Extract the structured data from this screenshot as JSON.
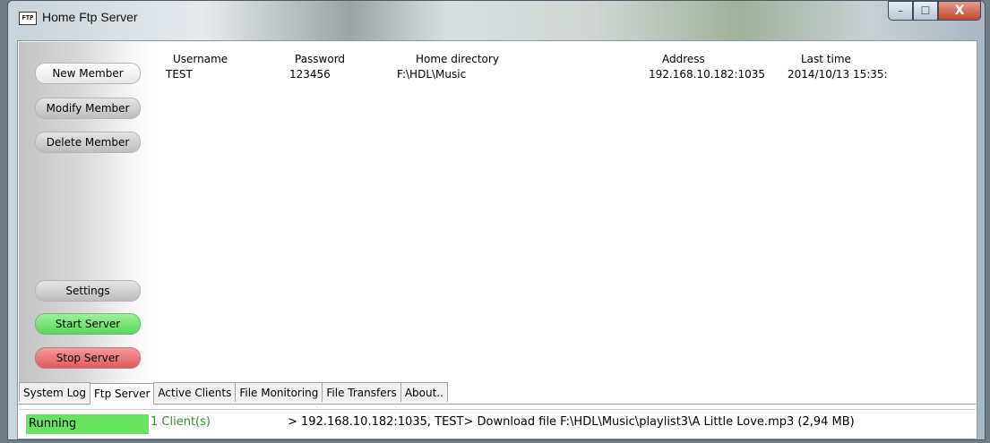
{
  "window": {
    "icon_text": "FTP",
    "title": "Home Ftp Server",
    "controls": {
      "minimize": "–",
      "maximize": "☐",
      "close": "X"
    }
  },
  "sidebar": {
    "new_member": "New Member",
    "modify_member": "Modify Member",
    "delete_member": "Delete Member",
    "settings": "Settings",
    "start_server": "Start Server",
    "stop_server": "Stop Server"
  },
  "table": {
    "columns": [
      "Username",
      "Password",
      "Home directory",
      "Address",
      "Last time"
    ],
    "rows": [
      [
        "TEST",
        "123456",
        "F:\\HDL\\Music",
        "192.168.10.182:1035",
        "2014/10/13 15:35:"
      ]
    ]
  },
  "tabs": [
    {
      "label": "System Log",
      "active": false
    },
    {
      "label": "Ftp Server",
      "active": true
    },
    {
      "label": "Active Clients",
      "active": false
    },
    {
      "label": "File Monitoring",
      "active": false
    },
    {
      "label": "File Transfers",
      "active": false
    },
    {
      "label": "About..",
      "active": false
    }
  ],
  "status": {
    "state": "Running",
    "clients": "1 Client(s)",
    "log": "> 192.168.10.182:1035, TEST> Download file F:\\HDL\\Music\\playlist3\\A Little Love.mp3 (2,94 MB)"
  },
  "colors": {
    "running": "#66e35f",
    "start": "#58d85a",
    "stop": "#e05a5a",
    "clients_text": "#3a8a3a"
  }
}
